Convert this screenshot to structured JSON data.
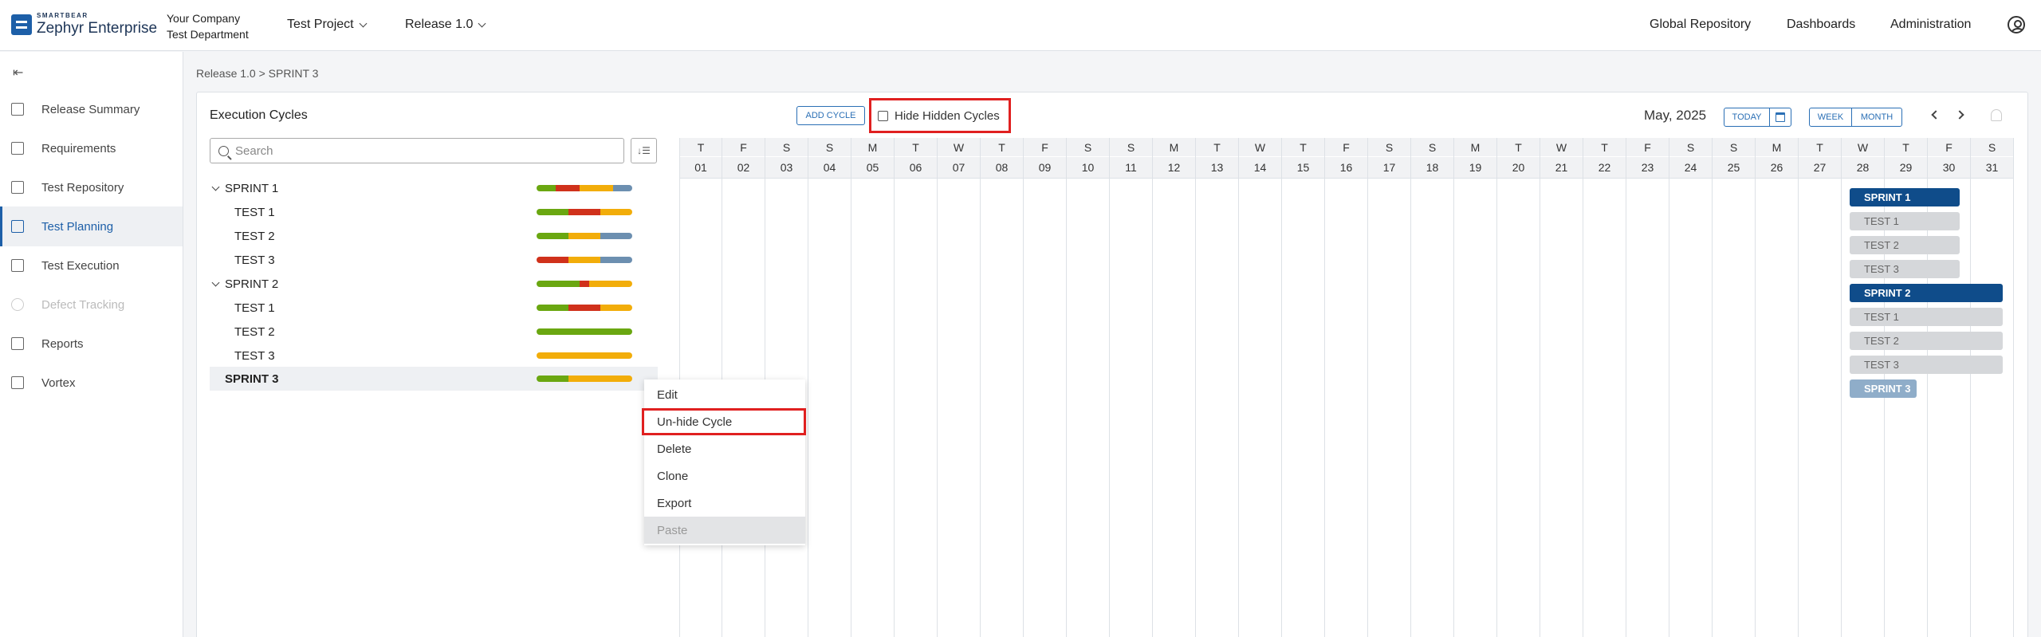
{
  "header": {
    "brand_small": "SMARTBEAR",
    "brand_main": "Zephyr Enterprise",
    "company": "Your Company",
    "department": "Test Department",
    "project": "Test Project",
    "release": "Release 1.0",
    "nav": [
      "Global Repository",
      "Dashboards",
      "Administration"
    ]
  },
  "sidebar": {
    "items": [
      {
        "label": "Release Summary",
        "icon": "release-summary-icon"
      },
      {
        "label": "Requirements",
        "icon": "requirements-icon"
      },
      {
        "label": "Test Repository",
        "icon": "folder-icon"
      },
      {
        "label": "Test Planning",
        "icon": "calendar-icon",
        "active": true
      },
      {
        "label": "Test Execution",
        "icon": "test-execution-icon"
      },
      {
        "label": "Defect Tracking",
        "icon": "bug-icon",
        "disabled": true
      },
      {
        "label": "Reports",
        "icon": "reports-icon"
      },
      {
        "label": "Vortex",
        "icon": "vortex-icon"
      }
    ]
  },
  "breadcrumb": "Release 1.0  >  SPRINT 3",
  "panel": {
    "title": "Execution Cycles",
    "add_cycle": "ADD CYCLE",
    "hide_hidden": "Hide Hidden Cycles",
    "month": "May, 2025",
    "today": "TODAY",
    "week": "WEEK",
    "monthbtn": "MONTH",
    "search_placeholder": "Search"
  },
  "tree": [
    {
      "label": "SPRINT 1",
      "level": 0,
      "bar": [
        [
          "green",
          0.2
        ],
        [
          "red",
          0.25
        ],
        [
          "yellow",
          0.35
        ],
        [
          "blue",
          0.2
        ]
      ]
    },
    {
      "label": "TEST 1",
      "level": 1,
      "bar": [
        [
          "green",
          0.33
        ],
        [
          "red",
          0.34
        ],
        [
          "yellow",
          0.33
        ]
      ]
    },
    {
      "label": "TEST 2",
      "level": 1,
      "bar": [
        [
          "green",
          0.33
        ],
        [
          "yellow",
          0.34
        ],
        [
          "blue",
          0.33
        ]
      ]
    },
    {
      "label": "TEST 3",
      "level": 1,
      "bar": [
        [
          "red",
          0.33
        ],
        [
          "yellow",
          0.34
        ],
        [
          "blue",
          0.33
        ]
      ]
    },
    {
      "label": "SPRINT 2",
      "level": 0,
      "bar": [
        [
          "green",
          0.45
        ],
        [
          "red",
          0.1
        ],
        [
          "yellow",
          0.45
        ]
      ]
    },
    {
      "label": "TEST 1",
      "level": 1,
      "bar": [
        [
          "green",
          0.33
        ],
        [
          "red",
          0.34
        ],
        [
          "yellow",
          0.33
        ]
      ]
    },
    {
      "label": "TEST 2",
      "level": 1,
      "bar": [
        [
          "green",
          1.0
        ]
      ]
    },
    {
      "label": "TEST 3",
      "level": 1,
      "bar": [
        [
          "yellow",
          1.0
        ]
      ]
    },
    {
      "label": "SPRINT 3",
      "level": 0,
      "selected": true,
      "bar": [
        [
          "green",
          0.33
        ],
        [
          "yellow",
          0.67
        ]
      ]
    }
  ],
  "calendar": {
    "days": [
      "T",
      "F",
      "S",
      "S",
      "M",
      "T",
      "W",
      "T",
      "F",
      "S",
      "S",
      "M",
      "T",
      "W",
      "T",
      "F",
      "S",
      "S",
      "M",
      "T",
      "W",
      "T",
      "F",
      "S",
      "S",
      "M",
      "T",
      "W",
      "T",
      "F",
      "S"
    ],
    "dates": [
      "01",
      "02",
      "03",
      "04",
      "05",
      "06",
      "07",
      "08",
      "09",
      "10",
      "11",
      "12",
      "13",
      "14",
      "15",
      "16",
      "17",
      "18",
      "19",
      "20",
      "21",
      "22",
      "23",
      "24",
      "25",
      "26",
      "27",
      "28",
      "29",
      "30",
      "31"
    ],
    "bars": [
      {
        "label": "SPRINT 1",
        "type": "sprint",
        "start": 28,
        "end": 30
      },
      {
        "label": "TEST 1",
        "type": "test",
        "start": 28,
        "end": 30
      },
      {
        "label": "TEST 2",
        "type": "test",
        "start": 28,
        "end": 30
      },
      {
        "label": "TEST 3",
        "type": "test",
        "start": 28,
        "end": 30
      },
      {
        "label": "SPRINT 2",
        "type": "sprint",
        "start": 28,
        "end": 31
      },
      {
        "label": "TEST 1",
        "type": "test",
        "start": 28,
        "end": 31
      },
      {
        "label": "TEST 2",
        "type": "test",
        "start": 28,
        "end": 31
      },
      {
        "label": "TEST 3",
        "type": "test",
        "start": 28,
        "end": 31
      },
      {
        "label": "SPRINT 3",
        "type": "sprint-h",
        "start": 28,
        "end": 29
      }
    ]
  },
  "context_menu": {
    "items": [
      {
        "label": "Edit"
      },
      {
        "label": "Un-hide Cycle",
        "highlighted": true
      },
      {
        "label": "Delete"
      },
      {
        "label": "Clone"
      },
      {
        "label": "Export"
      },
      {
        "label": "Paste",
        "disabled": true
      }
    ]
  },
  "colors": {
    "green": "#6aa711",
    "red": "#d0311b",
    "yellow": "#f2ad0a",
    "blue": "#6c8fb0",
    "accent": "#1d5fa8",
    "highlight": "#e02020"
  }
}
